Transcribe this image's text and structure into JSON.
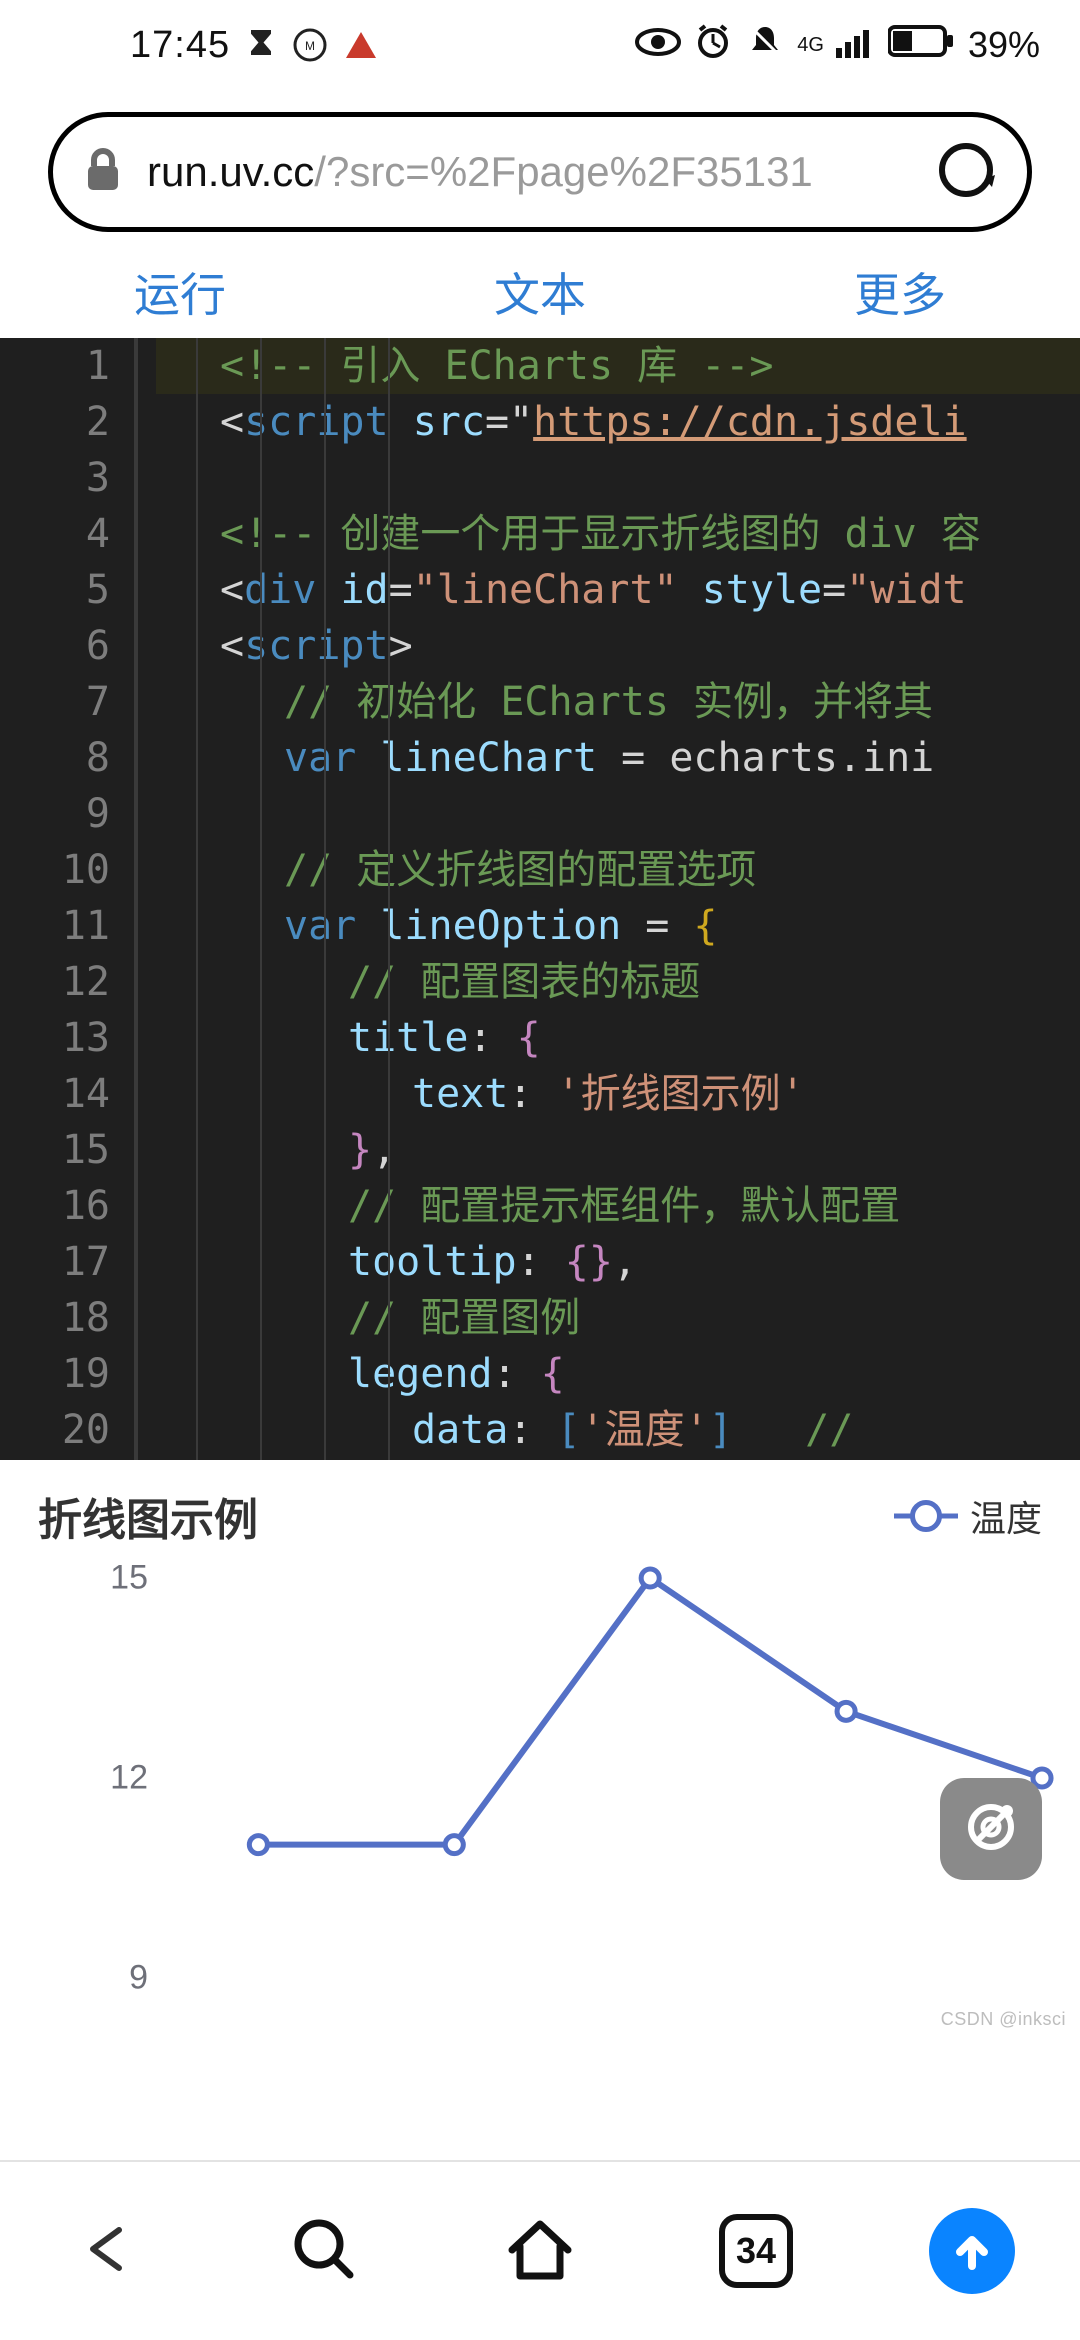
{
  "status": {
    "time": "17:45",
    "network_label": "4G",
    "battery_pct": "39%"
  },
  "urlbar": {
    "host": "run.uv.cc",
    "path": "/?src=%2Fpage%2F35131"
  },
  "tabs": {
    "run": "运行",
    "text": "文本",
    "more": "更多"
  },
  "code": {
    "lines": [
      {
        "n": "1",
        "ind": 1,
        "hi": true,
        "seg": [
          [
            "c-comment",
            "<!-- 引入 ECharts 库 -->"
          ]
        ]
      },
      {
        "n": "2",
        "ind": 1,
        "seg": [
          [
            "c-punc",
            "<"
          ],
          [
            "c-tag",
            "script"
          ],
          [
            "c-punc",
            " "
          ],
          [
            "c-attr",
            "src"
          ],
          [
            "c-punc",
            "="
          ],
          [
            "c-punc",
            "\""
          ],
          [
            "c-link",
            "https://cdn.jsdeli"
          ]
        ]
      },
      {
        "n": "3",
        "ind": 1,
        "seg": []
      },
      {
        "n": "4",
        "ind": 1,
        "seg": [
          [
            "c-comment",
            "<!-- 创建一个用于显示折线图的 div 容"
          ]
        ]
      },
      {
        "n": "5",
        "ind": 1,
        "seg": [
          [
            "c-punc",
            "<"
          ],
          [
            "c-tag",
            "div"
          ],
          [
            "c-punc",
            " "
          ],
          [
            "c-attr",
            "id"
          ],
          [
            "c-punc",
            "="
          ],
          [
            "c-str",
            "\"lineChart\""
          ],
          [
            "c-punc",
            " "
          ],
          [
            "c-attr",
            "style"
          ],
          [
            "c-punc",
            "="
          ],
          [
            "c-str",
            "\"widt"
          ]
        ]
      },
      {
        "n": "6",
        "ind": 1,
        "seg": [
          [
            "c-punc",
            "<"
          ],
          [
            "c-tag",
            "script"
          ],
          [
            "c-punc",
            ">"
          ]
        ]
      },
      {
        "n": "7",
        "ind": 2,
        "seg": [
          [
            "c-comment",
            "// 初始化 ECharts 实例，并将其"
          ]
        ]
      },
      {
        "n": "8",
        "ind": 2,
        "seg": [
          [
            "c-key",
            "var"
          ],
          [
            "c-punc",
            " "
          ],
          [
            "c-ident",
            "lineChart"
          ],
          [
            "c-punc",
            " = echarts.ini"
          ]
        ]
      },
      {
        "n": "9",
        "ind": 2,
        "seg": []
      },
      {
        "n": "10",
        "ind": 2,
        "seg": [
          [
            "c-comment",
            "// 定义折线图的配置选项"
          ]
        ]
      },
      {
        "n": "11",
        "ind": 2,
        "seg": [
          [
            "c-key",
            "var"
          ],
          [
            "c-punc",
            " "
          ],
          [
            "c-ident",
            "lineOption"
          ],
          [
            "c-punc",
            " = "
          ],
          [
            "c-brace",
            "{"
          ]
        ]
      },
      {
        "n": "12",
        "ind": 3,
        "seg": [
          [
            "c-comment",
            "// 配置图表的标题"
          ]
        ]
      },
      {
        "n": "13",
        "ind": 3,
        "seg": [
          [
            "c-ident",
            "title"
          ],
          [
            "c-punc",
            ": "
          ],
          [
            "c-brace2",
            "{"
          ]
        ]
      },
      {
        "n": "14",
        "ind": 4,
        "seg": [
          [
            "c-ident",
            "text"
          ],
          [
            "c-punc",
            ": "
          ],
          [
            "c-str",
            "'折线图示例'"
          ]
        ]
      },
      {
        "n": "15",
        "ind": 3,
        "seg": [
          [
            "c-brace2",
            "}"
          ],
          [
            "c-punc",
            ","
          ]
        ]
      },
      {
        "n": "16",
        "ind": 3,
        "seg": [
          [
            "c-comment",
            "// 配置提示框组件，默认配置"
          ]
        ]
      },
      {
        "n": "17",
        "ind": 3,
        "seg": [
          [
            "c-ident",
            "tooltip"
          ],
          [
            "c-punc",
            ": "
          ],
          [
            "c-brace2",
            "{}"
          ],
          [
            "c-punc",
            ","
          ]
        ]
      },
      {
        "n": "18",
        "ind": 3,
        "seg": [
          [
            "c-comment",
            "// 配置图例"
          ]
        ]
      },
      {
        "n": "19",
        "ind": 3,
        "seg": [
          [
            "c-ident",
            "legend"
          ],
          [
            "c-punc",
            ": "
          ],
          [
            "c-brace2",
            "{"
          ]
        ]
      },
      {
        "n": "20",
        "ind": 4,
        "seg": [
          [
            "c-ident",
            "data"
          ],
          [
            "c-punc",
            ": "
          ],
          [
            "c-brkt",
            "["
          ],
          [
            "c-str",
            "'温度'"
          ],
          [
            "c-brkt",
            "]"
          ],
          [
            "c-punc",
            "   "
          ],
          [
            "c-comment",
            "// "
          ]
        ]
      }
    ]
  },
  "chart": {
    "title": "折线图示例",
    "legend_label": "温度",
    "watermark": "CSDN @inksci"
  },
  "chart_data": {
    "type": "line",
    "title": "折线图示例",
    "series": [
      {
        "name": "温度",
        "values": [
          11,
          11,
          15,
          13,
          12
        ]
      }
    ],
    "y_ticks": [
      9,
      12,
      15
    ],
    "ylim": [
      9,
      15
    ],
    "color": "#5470c6"
  },
  "bottom": {
    "tab_count": "34"
  }
}
